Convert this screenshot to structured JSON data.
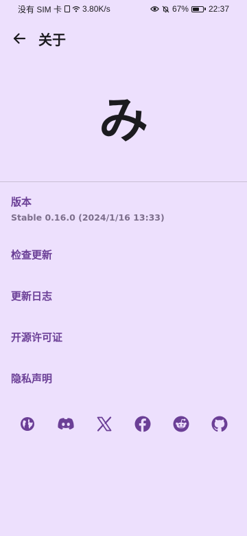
{
  "status_bar": {
    "carrier": "没有 SIM 卡",
    "network_speed": "3.80K/s",
    "battery_percent": "67%",
    "battery_level": 0.67,
    "time": "22:37",
    "icons": [
      "sim-icon",
      "wifi-icon",
      "eye-icon",
      "mute-bell-icon",
      "battery-icon"
    ]
  },
  "app_bar": {
    "back_icon": "arrow-back-icon",
    "title": "关于"
  },
  "logo": {
    "text": "み"
  },
  "version": {
    "label": "版本",
    "value": "Stable 0.16.0 (2024/1/16 13:33)"
  },
  "menu": [
    {
      "label": "检查更新"
    },
    {
      "label": "更新日志"
    },
    {
      "label": "开源许可证"
    },
    {
      "label": "隐私声明"
    }
  ],
  "social": {
    "accent_color": "#6b3f96",
    "icons": [
      "globe-icon",
      "discord-icon",
      "x-icon",
      "facebook-icon",
      "reddit-icon",
      "github-icon"
    ]
  },
  "colors": {
    "background": "#ede0fd",
    "accent": "#6b3f96",
    "secondary_text": "#7d6f8c"
  }
}
